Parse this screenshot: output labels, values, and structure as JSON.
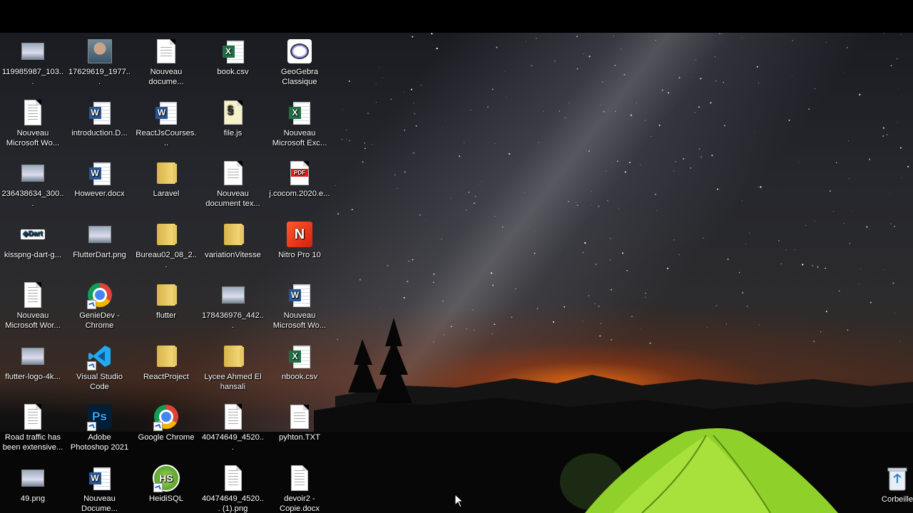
{
  "desktop": {
    "icons": [
      {
        "label": "119985987_103...",
        "icon": "image-thumbnail-icon",
        "col": 0,
        "row": 0
      },
      {
        "label": "17629619_1977...",
        "icon": "photo-portrait-icon",
        "col": 1,
        "row": 0
      },
      {
        "label": "Nouveau docume...",
        "icon": "text-document-icon",
        "col": 2,
        "row": 0
      },
      {
        "label": "book.csv",
        "icon": "excel-csv-icon",
        "col": 3,
        "row": 0
      },
      {
        "label": "GeoGebra Classique",
        "icon": "geogebra-icon",
        "col": 4,
        "row": 0
      },
      {
        "label": "Nouveau Microsoft Wo...",
        "icon": "word-document-thumbnail-icon",
        "col": 0,
        "row": 1
      },
      {
        "label": "introduction.D...",
        "icon": "word-icon",
        "col": 1,
        "row": 1
      },
      {
        "label": "ReactJsCourses...",
        "icon": "word-icon",
        "col": 2,
        "row": 1
      },
      {
        "label": "file.js",
        "icon": "javascript-file-icon",
        "col": 3,
        "row": 1
      },
      {
        "label": "Nouveau Microsoft Exc...",
        "icon": "excel-icon",
        "col": 4,
        "row": 1
      },
      {
        "label": "236438634_300...",
        "icon": "image-thumbnail-icon",
        "col": 0,
        "row": 2
      },
      {
        "label": "However.docx",
        "icon": "word-icon",
        "col": 1,
        "row": 2
      },
      {
        "label": "Laravel",
        "icon": "folder-icon",
        "col": 2,
        "row": 2
      },
      {
        "label": "Nouveau document tex...",
        "icon": "text-document-icon",
        "col": 3,
        "row": 2
      },
      {
        "label": "j.cocom.2020.e...",
        "icon": "pdf-icon",
        "col": 4,
        "row": 2
      },
      {
        "label": "kisspng-dart-g...",
        "icon": "dart-logo-icon",
        "col": 0,
        "row": 3
      },
      {
        "label": "FlutterDart.png",
        "icon": "image-thumbnail-icon",
        "col": 1,
        "row": 3
      },
      {
        "label": "Bureau02_08_2...",
        "icon": "folder-icon",
        "col": 2,
        "row": 3
      },
      {
        "label": "variationVitesse",
        "icon": "folder-icon",
        "col": 3,
        "row": 3
      },
      {
        "label": "Nitro Pro 10",
        "icon": "nitro-pro-icon",
        "col": 4,
        "row": 3
      },
      {
        "label": "Nouveau Microsoft Wor...",
        "icon": "word-document-thumbnail-icon",
        "col": 0,
        "row": 4
      },
      {
        "label": "GenieDev - Chrome",
        "icon": "chrome-profile-icon",
        "col": 1,
        "row": 4
      },
      {
        "label": "flutter",
        "icon": "folder-icon",
        "col": 2,
        "row": 4
      },
      {
        "label": "178436976_442...",
        "icon": "image-thumbnail-icon",
        "col": 3,
        "row": 4
      },
      {
        "label": "Nouveau Microsoft Wo...",
        "icon": "word-icon",
        "col": 4,
        "row": 4
      },
      {
        "label": "flutter-logo-4k...",
        "icon": "image-thumbnail-icon",
        "col": 0,
        "row": 5
      },
      {
        "label": "Visual Studio Code",
        "icon": "vscode-icon",
        "col": 1,
        "row": 5
      },
      {
        "label": "ReactProject",
        "icon": "folder-icon",
        "col": 2,
        "row": 5
      },
      {
        "label": "Lycee Ahmed El hansali",
        "icon": "folder-icon",
        "col": 3,
        "row": 5
      },
      {
        "label": "nbook.csv",
        "icon": "excel-csv-icon",
        "col": 4,
        "row": 5
      },
      {
        "label": "Road traffic has been extensive...",
        "icon": "document-thumbnail-icon",
        "col": 0,
        "row": 6
      },
      {
        "label": "Adobe Photoshop 2021",
        "icon": "photoshop-icon",
        "col": 1,
        "row": 6
      },
      {
        "label": "Google Chrome",
        "icon": "chrome-icon",
        "col": 2,
        "row": 6
      },
      {
        "label": "40474649_4520...",
        "icon": "document-thumbnail-icon",
        "col": 3,
        "row": 6
      },
      {
        "label": "pyhton.TXT",
        "icon": "text-document-icon",
        "col": 4,
        "row": 6
      },
      {
        "label": "49.png",
        "icon": "image-thumbnail-icon",
        "col": 0,
        "row": 7
      },
      {
        "label": "Nouveau Docume...",
        "icon": "word-icon",
        "col": 1,
        "row": 7
      },
      {
        "label": "HeidiSQL",
        "icon": "heidisql-icon",
        "col": 2,
        "row": 7
      },
      {
        "label": "40474649_4520... (1).png",
        "icon": "document-thumbnail-icon",
        "col": 3,
        "row": 7
      },
      {
        "label": "devoir2 - Copie.docx",
        "icon": "word-document-thumbnail-icon",
        "col": 4,
        "row": 7
      }
    ],
    "recycle_bin": {
      "label": "Corbeille",
      "icon": "recycle-bin-icon"
    }
  },
  "colors": {
    "word_blue": "#2b5797",
    "excel_green": "#1e7145",
    "pdf_red": "#e02020",
    "folder_yellow": "#f0cf6a",
    "tent_green": "#8fd12a",
    "horizon_orange": "#ff7a1a"
  }
}
